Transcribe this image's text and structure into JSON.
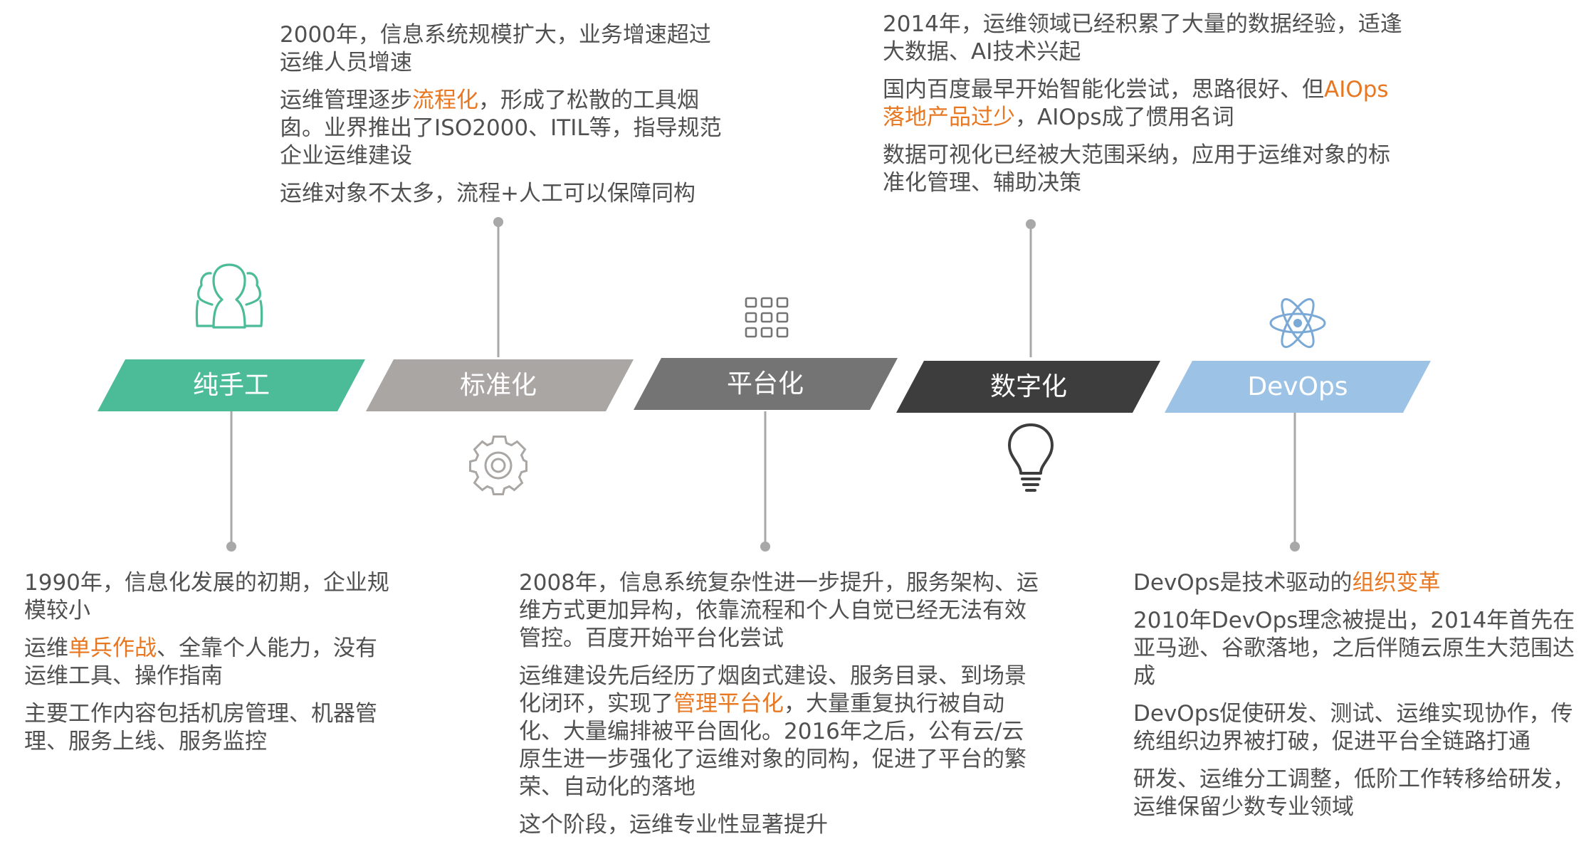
{
  "colors": {
    "stage_manual": "#4cbb98",
    "stage_standard": "#a9a6a4",
    "stage_platform": "#747474",
    "stage_digital": "#3d3d3d",
    "stage_devops": "#9cc3e6",
    "highlight": "#e87722",
    "connector": "#a8a8a8",
    "text": "#505050"
  },
  "stages": [
    {
      "label": "纯手工",
      "icon": "people-group-icon"
    },
    {
      "label": "标准化",
      "icon": "gear-icon"
    },
    {
      "label": "平台化",
      "icon": "grid-icon"
    },
    {
      "label": "数字化",
      "icon": "lightbulb-icon"
    },
    {
      "label": "DevOps",
      "icon": "atom-icon"
    }
  ],
  "notes": {
    "manual": {
      "p1": "1990年，信息化发展的初期，企业规模较小",
      "p2_pre": "运维",
      "p2_hl": "单兵作战",
      "p2_post": "、全靠个人能力，没有运维工具、操作指南",
      "p3": "主要工作内容包括机房管理、机器管理、服务上线、服务监控"
    },
    "standard": {
      "p1": "2000年，信息系统规模扩大，业务增速超过运维人员增速",
      "p2_pre": "运维管理逐步",
      "p2_hl": "流程化",
      "p2_post": "，形成了松散的工具烟囱。业界推出了ISO2000、ITIL等，指导规范企业运维建设",
      "p3": "运维对象不太多，流程+人工可以保障同构"
    },
    "platform": {
      "p1": "2008年，信息系统复杂性进一步提升，服务架构、运维方式更加异构，依靠流程和个人自觉已经无法有效管控。百度开始平台化尝试",
      "p2_pre": "运维建设先后经历了烟囱式建设、服务目录、到场景化闭环，实现了",
      "p2_hl": "管理平台化",
      "p2_post": "，大量重复执行被自动化、大量编排被平台固化。2016年之后，公有云/云原生进一步强化了运维对象的同构，促进了平台的繁荣、自动化的落地",
      "p3": "这个阶段，运维专业性显著提升"
    },
    "digital": {
      "p1": "2014年，运维领域已经积累了大量的数据经验，适逢大数据、AI技术兴起",
      "p2_pre": "国内百度最早开始智能化尝试，思路很好、但",
      "p2_hl": "AIOps落地产品过少",
      "p2_post": "，AIOps成了惯用名词",
      "p3": "数据可视化已经被大范围采纳，应用于运维对象的标准化管理、辅助决策"
    },
    "devops": {
      "p1_pre": "DevOps是技术驱动的",
      "p1_hl": "组织变革",
      "p2": "2010年DevOps理念被提出，2014年首先在亚马逊、谷歌落地，之后伴随云原生大范围达成",
      "p3": "DevOps促使研发、测试、运维实现协作，传统组织边界被打破，促进平台全链路打通",
      "p4": "研发、运维分工调整，低阶工作转移给研发，运维保留少数专业领域"
    }
  }
}
